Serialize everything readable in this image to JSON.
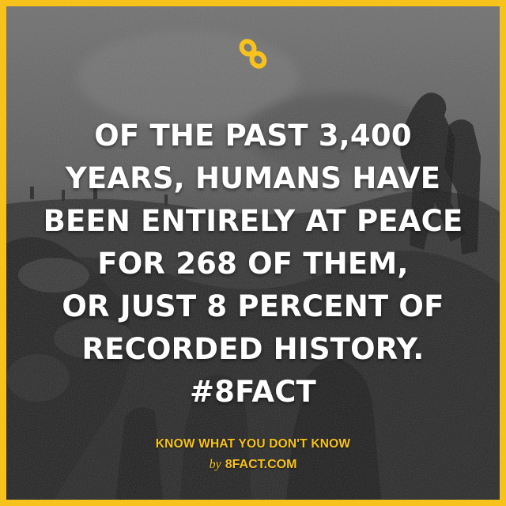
{
  "brand": {
    "accent_color": "#f7c21b",
    "logo_icon": "infinity-8-icon"
  },
  "fact": {
    "lines": [
      "OF THE PAST 3,400",
      "YEARS, HUMANS HAVE",
      "BEEN ENTIRELY AT PEACE",
      "FOR 268 OF THEM,",
      "OR JUST 8 PERCENT OF",
      "RECORDED HISTORY.",
      "#8FACT"
    ]
  },
  "footer": {
    "tagline": "KNOW WHAT YOU DON'T KNOW",
    "by": "by",
    "site": "8FACT.COM"
  }
}
